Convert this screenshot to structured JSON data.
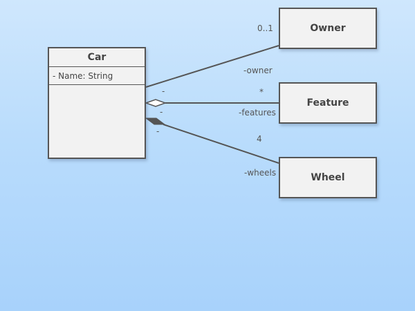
{
  "diagram": {
    "classes": {
      "car": {
        "name": "Car",
        "attributes": [
          "- Name: String"
        ]
      },
      "owner": {
        "name": "Owner"
      },
      "feature": {
        "name": "Feature"
      },
      "wheel": {
        "name": "Wheel"
      }
    },
    "associations": {
      "owner": {
        "multiplicity": "0..1",
        "role": "-owner",
        "source_end": "-"
      },
      "feature": {
        "multiplicity": "*",
        "role": "-features",
        "source_end": "-"
      },
      "wheel": {
        "multiplicity": "4",
        "role": "-wheels",
        "source_end": "-"
      }
    },
    "colors": {
      "line": "#555555",
      "box_fill": "#f2f2f2",
      "background_top": "#cfe7fd",
      "background_bottom": "#a8d2fb"
    }
  }
}
